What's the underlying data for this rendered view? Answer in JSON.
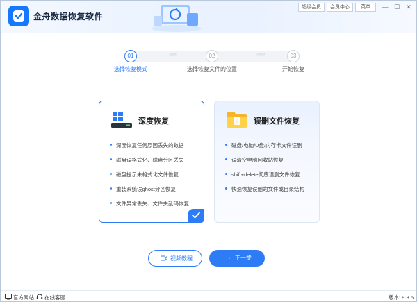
{
  "app": {
    "title": "金舟数据恢复软件"
  },
  "topbar": {
    "super_member": "超级会员",
    "member_center": "会员中心",
    "menu": "菜单"
  },
  "window_controls": {
    "minimize": "—",
    "maximize": "☐",
    "close": "✕"
  },
  "steps": [
    {
      "num": "01",
      "label": "选择恢复模式",
      "active": true
    },
    {
      "num": "02",
      "label": "选择恢复文件的位置",
      "active": false
    },
    {
      "num": "03",
      "label": "开始恢复",
      "active": false
    }
  ],
  "cards": {
    "deep": {
      "title": "深度恢复",
      "icon": "windows-drive-icon",
      "selected": true,
      "items": [
        "深度恢复任何原因丢失的数据",
        "磁盘误格式化、磁盘分区丢失",
        "磁盘提示未格式化文件恢复",
        "重装系统误ghost分区恢复",
        "文件异常丢失、文件夹乱码恢复"
      ]
    },
    "deleted": {
      "title": "误删文件恢复",
      "icon": "folder-trash-icon",
      "selected": false,
      "items": [
        "磁盘/电脑/U盘/内存卡文件误删",
        "误清空电脑回收站恢复",
        "shift+delete彻底误删文件恢复",
        "快速恢复误删的文件或目录结构"
      ]
    }
  },
  "buttons": {
    "video": "视频教程",
    "next": "下一步",
    "next_arrow": "→"
  },
  "footer": {
    "website": "官方网站",
    "support": "在线客服",
    "version": "版本: 9.3.5"
  },
  "colors": {
    "accent": "#2d7cf6"
  }
}
